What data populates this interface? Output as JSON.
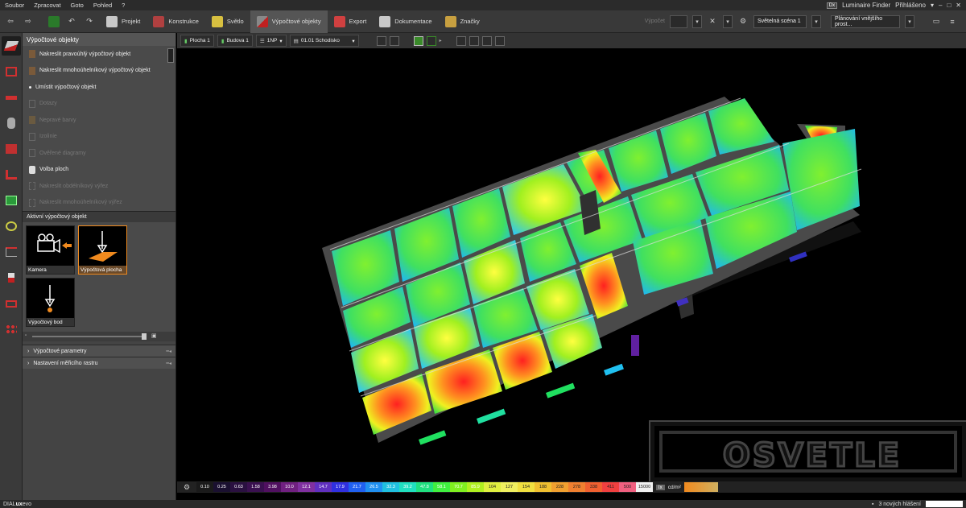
{
  "menu": [
    "Soubor",
    "Zpracovat",
    "Goto",
    "Pohled",
    "?"
  ],
  "menu_right": {
    "luminaire_finder": "Luminaire Finder",
    "login": "Přihlášeno",
    "badge": "Dx"
  },
  "toolbar": {
    "tabs": [
      {
        "label": "Projekt",
        "icon": "project-icon",
        "color": "#c8c8c8"
      },
      {
        "label": "Konstrukce",
        "icon": "construction-icon",
        "color": "#b04040"
      },
      {
        "label": "Světlo",
        "icon": "light-icon",
        "color": "#d8c040"
      },
      {
        "label": "Výpočtové objekty",
        "icon": "calc-objects-icon",
        "color": "#c02020",
        "active": true
      },
      {
        "label": "Export",
        "icon": "export-icon",
        "color": "#d04040"
      },
      {
        "label": "Dokumentace",
        "icon": "documentation-icon",
        "color": "#c8c8c8"
      },
      {
        "label": "Značky",
        "icon": "signs-icon",
        "color": "#c8a040"
      }
    ],
    "calc_label": "Výpočet",
    "scene": "Světelná scéna 1",
    "planning": "Plánování vnějšího prost..."
  },
  "sidebar_icons": [
    "calc-plane-icon",
    "room-icon",
    "table-icon",
    "cylinder-icon",
    "box-icon",
    "floor-icon",
    "exit-sign-icon",
    "eye-icon",
    "curve-icon",
    "graph-icon",
    "frame-icon",
    "grid-icon"
  ],
  "panel": {
    "title": "Výpočtové objekty",
    "items": [
      {
        "label": "Nakreslit pravoúhlý výpočtový objekt",
        "enabled": true
      },
      {
        "label": "Nakreslit mnohoúhelníkový výpočtový objekt",
        "enabled": true
      },
      {
        "label": "Umístit výpočtový objekt",
        "enabled": true
      },
      {
        "label": "Dotazy",
        "enabled": false
      },
      {
        "label": "Nepravé barvy",
        "enabled": false
      },
      {
        "label": "Izolinie",
        "enabled": false
      },
      {
        "label": "Ověřené diagramy",
        "enabled": false
      },
      {
        "label": "Volba ploch",
        "enabled": true
      },
      {
        "label": "Nakreslit obdélníkový výřez",
        "enabled": false
      },
      {
        "label": "Nakreslit mnohoúhelníkový výřez",
        "enabled": false
      }
    ],
    "active_object_title": "Aktivní výpočtový objekt",
    "objects": [
      {
        "label": "Kamera",
        "selected": false
      },
      {
        "label": "Výpočtová plocha",
        "selected": true
      },
      {
        "label": "Výpočtový bod",
        "selected": false
      }
    ],
    "accordions": [
      "Výpočtové parametry",
      "Nastavení měřicího rastru"
    ]
  },
  "viewport_bar": {
    "plocha": "Plocha 1",
    "budova": "Budova 1",
    "floor": "1NP",
    "stairs": "01.01 Schodisko"
  },
  "legend": {
    "values": [
      "0.10",
      "0.25",
      "0.63",
      "1.58",
      "3.98",
      "10.0",
      "12.1",
      "14.7",
      "17.9",
      "21.7",
      "26.5",
      "32.3",
      "39.2",
      "47.8",
      "58.1",
      "70.7",
      "85.9",
      "104",
      "127",
      "154",
      "188",
      "228",
      "278",
      "338",
      "411",
      "500",
      "15000"
    ],
    "colors": [
      "#1a1a1a",
      "#1a1030",
      "#2a1040",
      "#3a1050",
      "#501060",
      "#702080",
      "#8030a0",
      "#6030c0",
      "#3030e0",
      "#2060f0",
      "#2090f0",
      "#20c0e0",
      "#20e0c0",
      "#20e080",
      "#40f040",
      "#80f020",
      "#b0f020",
      "#e0f040",
      "#f0f060",
      "#f0e040",
      "#f0c030",
      "#f0a030",
      "#f08030",
      "#f06030",
      "#f04040",
      "#f06080",
      "#f0f0f0"
    ],
    "unit_lx": "lx",
    "unit_cd": "cd/m²"
  },
  "status": {
    "brand_prefix": "DIAL",
    "brand_mid": "ux",
    "brand_suffix": "evo",
    "messages": "3 nových hlášení"
  },
  "watermark": "OSVETLE"
}
